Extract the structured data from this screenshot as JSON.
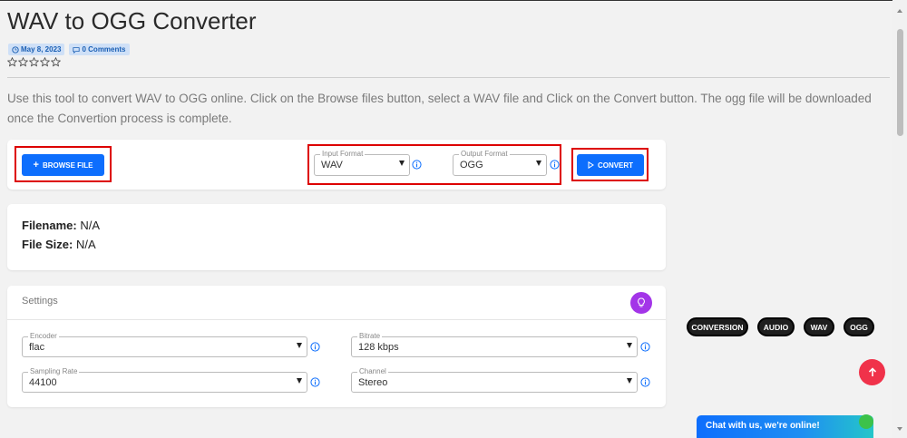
{
  "page": {
    "title": "WAV to OGG Converter",
    "date": "May 8, 2023",
    "comments": "0 Comments",
    "rating": 0,
    "intro": "Use this tool to convert WAV to OGG online. Click on the Browse files button, select a WAV file and Click on the Convert button. The ogg file will be downloaded once the Convertion process is complete."
  },
  "converter": {
    "browse_label": "BROWSE FILE",
    "input_format_label": "Input Format",
    "input_format_value": "WAV",
    "output_format_label": "Output Format",
    "output_format_value": "OGG",
    "convert_label": "CONVERT"
  },
  "file_info": {
    "filename_label": "Filename:",
    "filename_value": "N/A",
    "filesize_label": "File Size:",
    "filesize_value": "N/A"
  },
  "settings": {
    "title": "Settings",
    "encoder_label": "Encoder",
    "encoder_value": "flac",
    "bitrate_label": "Bitrate",
    "bitrate_value": "128 kbps",
    "sampling_label": "Sampling Rate",
    "sampling_value": "44100",
    "channel_label": "Channel",
    "channel_value": "Stereo"
  },
  "tags": [
    "CONVERSION",
    "AUDIO",
    "WAV",
    "OGG"
  ],
  "chat": {
    "label": "Chat with us, we're online!"
  },
  "colors": {
    "accent": "#0d6efd",
    "highlight": "#dd0000",
    "purple": "#a335e8",
    "scroll_top": "#f0324a",
    "online": "#3cc24a"
  }
}
